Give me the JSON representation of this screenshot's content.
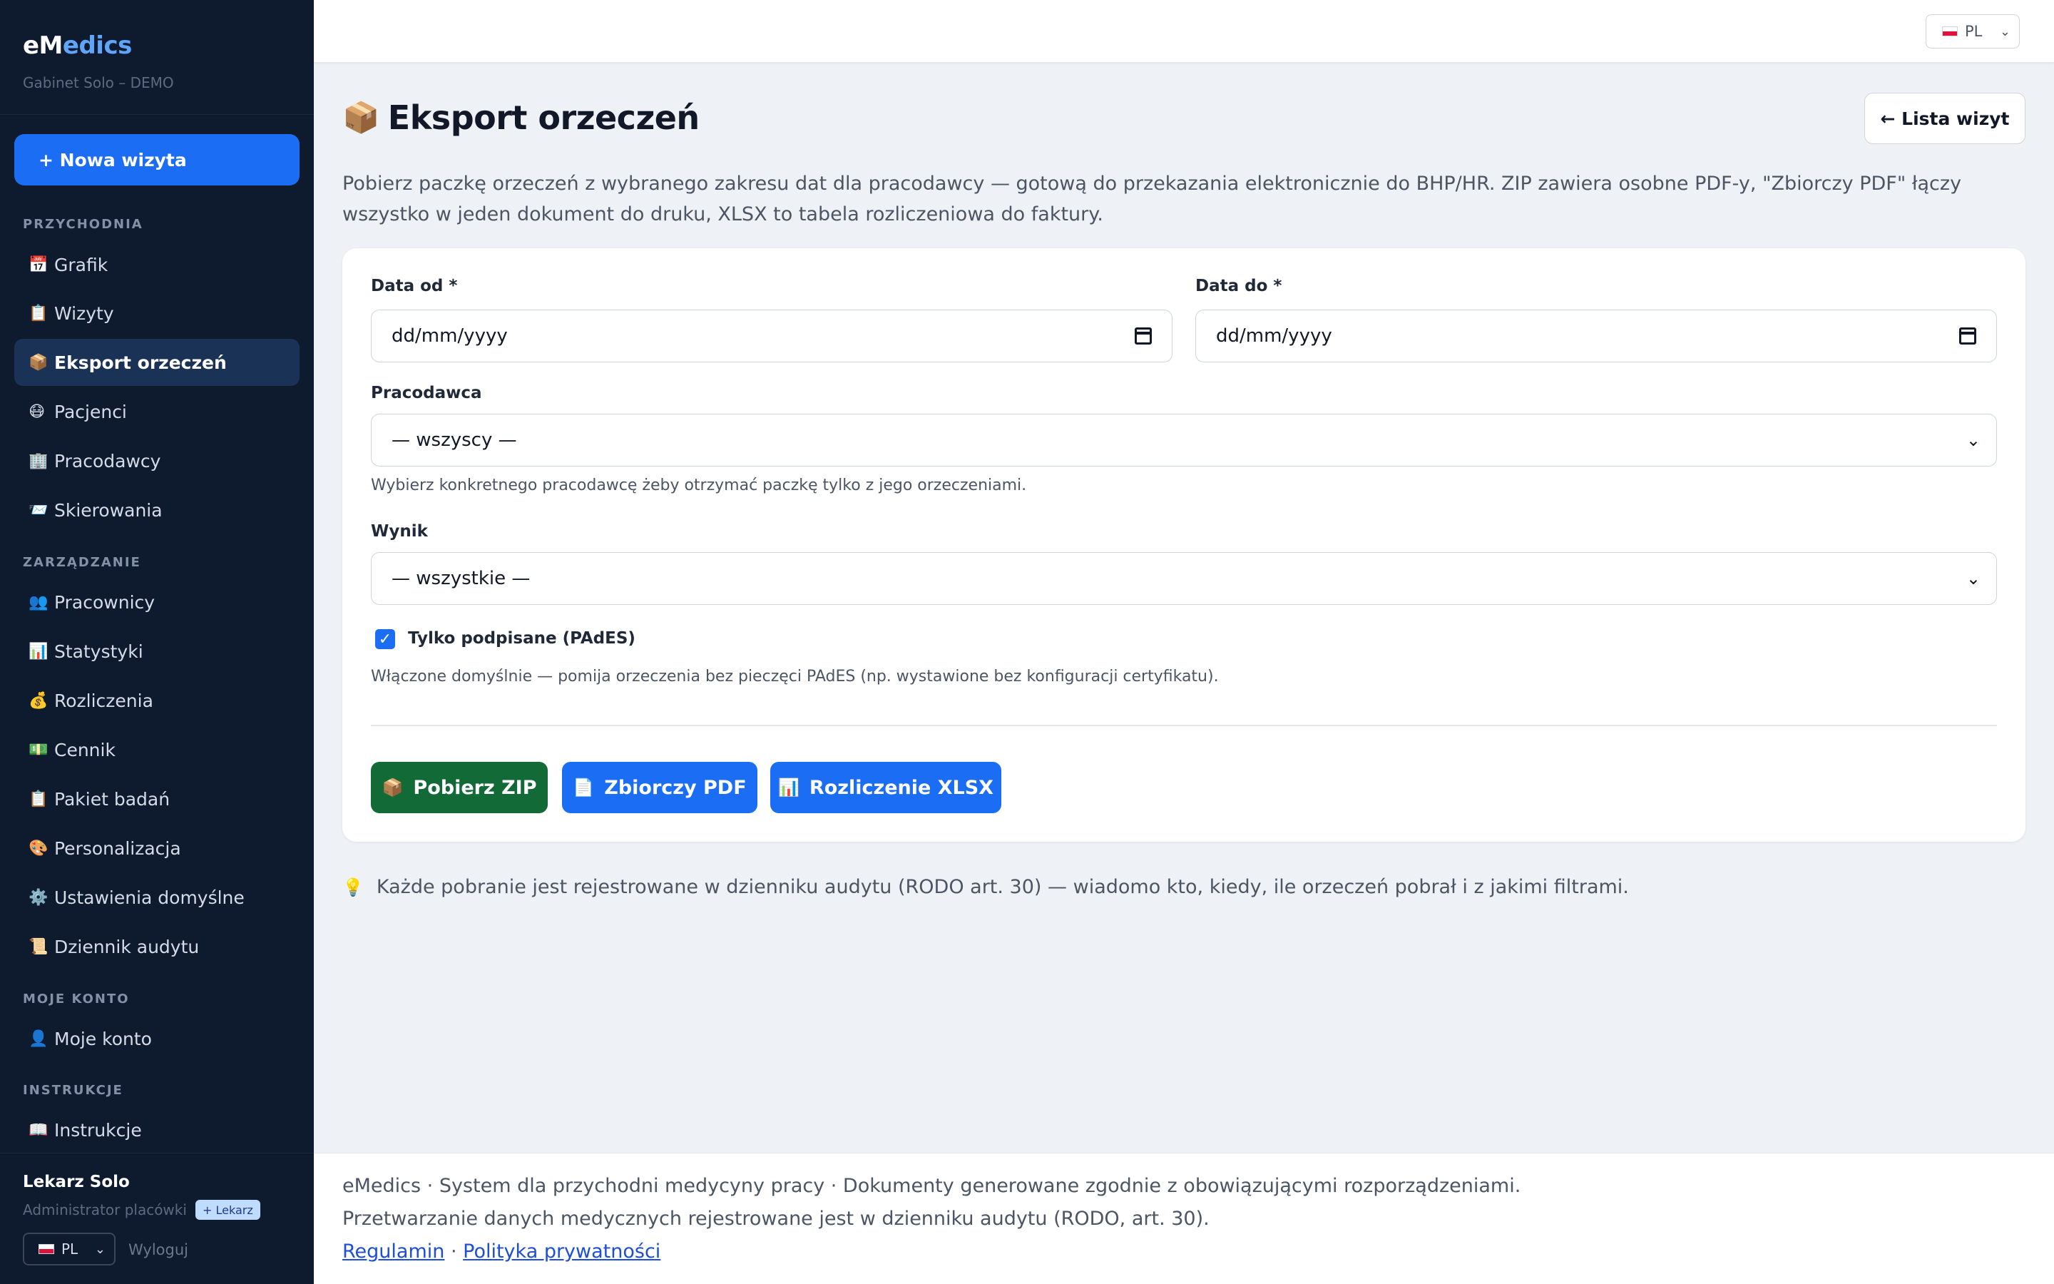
{
  "sidebar": {
    "brand_e": "eM",
    "brand_rest": "edics",
    "clinic": "Gabinet Solo – DEMO",
    "new_visit": "+ Nowa wizyta",
    "sections": {
      "clinic": "PRZYCHODNIA",
      "management": "ZARZĄDZANIE",
      "account": "MOJE KONTO",
      "help": "INSTRUKCJE"
    },
    "items": [
      {
        "icon": "📅",
        "label": "Grafik"
      },
      {
        "icon": "📋",
        "label": "Wizyty"
      },
      {
        "icon": "📦",
        "label": "Eksport orzeczeń"
      },
      {
        "icon": "😷",
        "label": "Pacjenci"
      },
      {
        "icon": "🏢",
        "label": "Pracodawcy"
      },
      {
        "icon": "📨",
        "label": "Skierowania"
      },
      {
        "icon": "👥",
        "label": "Pracownicy"
      },
      {
        "icon": "📊",
        "label": "Statystyki"
      },
      {
        "icon": "💰",
        "label": "Rozliczenia"
      },
      {
        "icon": "💵",
        "label": "Cennik"
      },
      {
        "icon": "📋",
        "label": "Pakiet badań"
      },
      {
        "icon": "🎨",
        "label": "Personalizacja"
      },
      {
        "icon": "⚙️",
        "label": "Ustawienia domyślne"
      },
      {
        "icon": "📜",
        "label": "Dziennik audytu"
      },
      {
        "icon": "👤",
        "label": "Moje konto"
      },
      {
        "icon": "📖",
        "label": "Instrukcje"
      }
    ],
    "user": {
      "name": "Lekarz Solo",
      "role": "Administrator placówki",
      "badge": "+ Lekarz",
      "lang": "PL",
      "logout": "Wyloguj"
    }
  },
  "topbar": {
    "lang": "PL"
  },
  "main": {
    "title_icon": "📦",
    "title": "Eksport orzeczeń",
    "back_button": "← Lista wizyt",
    "intro": "Pobierz paczkę orzeczeń z wybranego zakresu dat dla pracodawcy — gotową do przekazania elektronicznie do BHP/HR. ZIP zawiera osobne PDF-y, \"Zbiorczy PDF\" łączy wszystko w jeden dokument do druku, XLSX to tabela rozliczeniowa do faktury.",
    "form": {
      "date_from_label": "Data od *",
      "date_from_value": "dd/mm/yyyy",
      "date_to_label": "Data do *",
      "date_to_value": "dd/mm/yyyy",
      "employer_label": "Pracodawca",
      "employer_value": "— wszyscy —",
      "employer_help": "Wybierz konkretnego pracodawcę żeby otrzymać paczkę tylko z jego orzeczeniami.",
      "result_label": "Wynik",
      "result_value": "— wszystkie —",
      "signed_label": "Tylko podpisane (PAdES)",
      "signed_checked": true,
      "signed_help": "Włączone domyślnie — pomija orzeczenia bez pieczęci PAdES (np. wystawione bez konfiguracji certyfikatu)."
    },
    "buttons": {
      "zip_icon": "📦",
      "zip": "Pobierz ZIP",
      "pdf_icon": "📄",
      "pdf": "Zbiorczy PDF",
      "xlsx_icon": "📊",
      "xlsx": "Rozliczenie XLSX"
    },
    "audit_icon": "💡",
    "audit_note": "Każde pobranie jest rejestrowane w dzienniku audytu (RODO art. 30) — wiadomo kto, kiedy, ile orzeczeń pobrał i z jakimi filtrami."
  },
  "footer": {
    "line1": "eMedics · System dla przychodni medycyny pracy · Dokumenty generowane zgodnie z obowiązującymi rozporządzeniami.",
    "line2": "Przetwarzanie danych medycznych rejestrowane jest w dzienniku audytu (RODO, art. 30).",
    "terms": "Regulamin",
    "sep": " · ",
    "privacy": "Polityka prywatności"
  },
  "colors": {
    "sidebar_bg": "#0e1a2e",
    "primary": "#1b6ef3",
    "success": "#126a36",
    "active_item": "#1a3256"
  }
}
